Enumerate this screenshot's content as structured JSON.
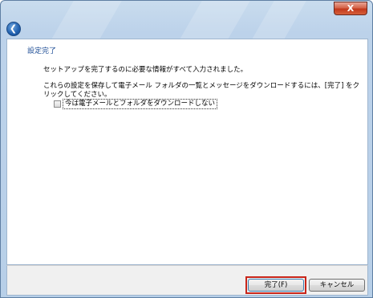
{
  "window": {
    "close_label": "X",
    "back_icon": "back-arrow-icon"
  },
  "content": {
    "heading": "設定完了",
    "message1": "セットアップを完了するのに必要な情報がすべて入力されました。",
    "message2": "これらの設定を保存して電子メール フォルダの一覧とメッセージをダウンロードするには、[完了] をクリックしてください。",
    "checkbox_label": "今は電子メールとフォルダをダウンロードしない",
    "checkbox_checked": false
  },
  "footer": {
    "finish_label": "完了(F)",
    "cancel_label": "キャンセル"
  },
  "colors": {
    "heading": "#1f4e96",
    "highlight": "#c8251a"
  }
}
